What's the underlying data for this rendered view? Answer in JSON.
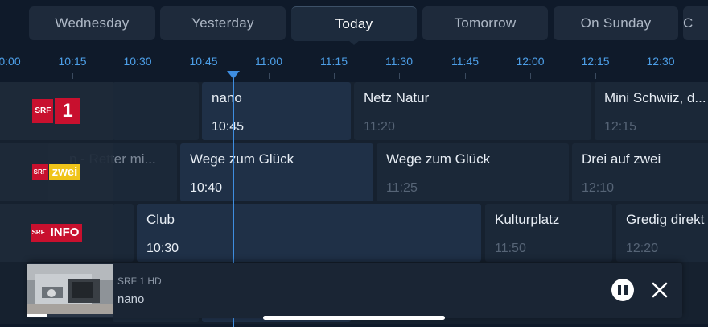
{
  "tabs": [
    {
      "label": "Wednesday",
      "active": false
    },
    {
      "label": "Yesterday",
      "active": false
    },
    {
      "label": "Today",
      "active": true
    },
    {
      "label": "Tomorrow",
      "active": false
    },
    {
      "label": "On Sunday",
      "active": false
    },
    {
      "label": "C",
      "active": false
    }
  ],
  "timeline": [
    "0:00",
    "10:15",
    "10:30",
    "10:45",
    "11:00",
    "11:15",
    "11:30",
    "11:45",
    "12:00",
    "12:15",
    "12:30"
  ],
  "channels": [
    {
      "id": "srf1",
      "logo_text": "SRF",
      "logo_numeral": "1",
      "programs": [
        {
          "title": "",
          "time": "",
          "state": "past"
        },
        {
          "title": "nano",
          "time": "10:45",
          "state": "current"
        },
        {
          "title": "Netz Natur",
          "time": "11:20",
          "state": "future"
        },
        {
          "title": "Mini Schwiiz, d...",
          "time": "12:15",
          "state": "future"
        }
      ]
    },
    {
      "id": "srfzwei",
      "logo_text": "SRF",
      "logo_word": "zwei",
      "programs": [
        {
          "title": "n - Retter mi...",
          "time": "",
          "state": "past"
        },
        {
          "title": "Wege zum Glück",
          "time": "10:40",
          "state": "current"
        },
        {
          "title": "Wege zum Glück",
          "time": "11:25",
          "state": "future"
        },
        {
          "title": "Drei auf zwei",
          "time": "12:10",
          "state": "future"
        }
      ]
    },
    {
      "id": "srfinfo",
      "logo_text": "SRF",
      "logo_word": "INFO",
      "programs": [
        {
          "title": "",
          "time": "",
          "state": "past"
        },
        {
          "title": "Club",
          "time": "10:30",
          "state": "current"
        },
        {
          "title": "Kulturplatz",
          "time": "11:50",
          "state": "future"
        },
        {
          "title": "Gredig direkt",
          "time": "12:20",
          "state": "future"
        }
      ]
    }
  ],
  "mini_player": {
    "channel": "SRF 1 HD",
    "title": "nano",
    "progress": 0.22
  },
  "colors": {
    "accent": "#3e8de0",
    "srf_red": "#c8102e",
    "zwei_yellow": "#f0c419"
  }
}
